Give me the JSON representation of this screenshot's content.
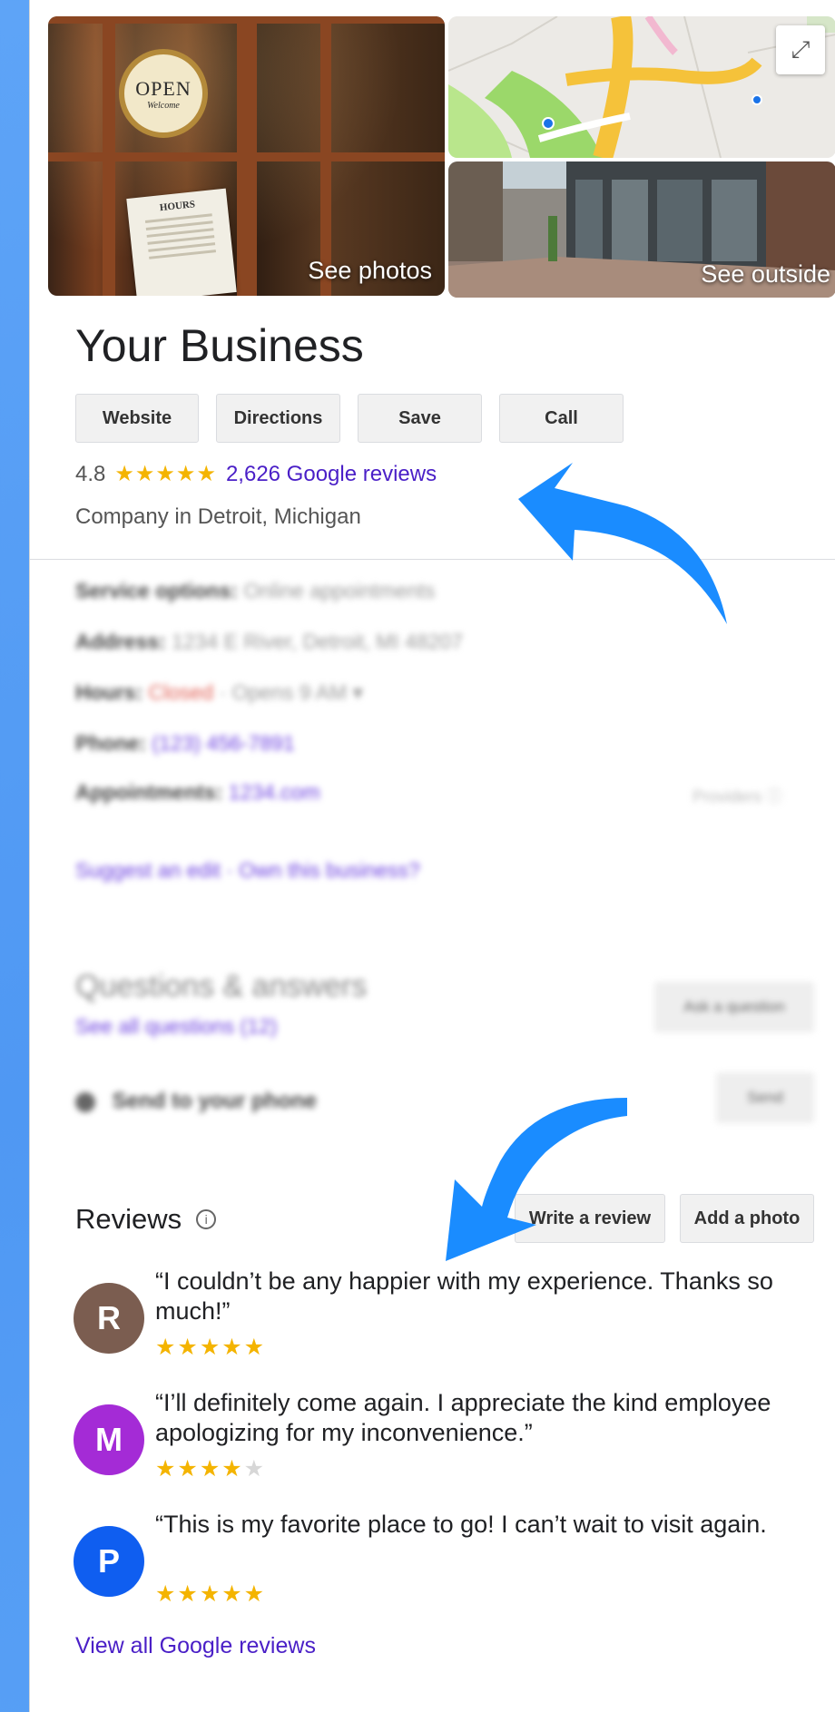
{
  "photos": {
    "open_sign": {
      "line1": "OPEN",
      "line2": "Welcome"
    },
    "hours_sign": "HOURS",
    "see_photos_label": "See photos",
    "see_outside_label": "See outside"
  },
  "business": {
    "name": "Your Business",
    "actions": [
      "Website",
      "Directions",
      "Save",
      "Call"
    ],
    "rating": "4.8",
    "rating_stars": "★★★★★",
    "reviews_link": "2,626 Google reviews",
    "category": "Company in Detroit, Michigan"
  },
  "info": {
    "service_label": "Service options:",
    "service_value": "Online appointments",
    "address_label": "Address:",
    "address_value": "1234 E River, Detroit, MI 48207",
    "hours_label": "Hours:",
    "hours_status": "Closed",
    "hours_value": "· Opens 9 AM ▾",
    "phone_label": "Phone:",
    "phone_value": "(123) 456-7891",
    "appointments_label": "Appointments:",
    "appointments_value": "1234.com",
    "providers": "Providers ⓘ",
    "suggest_edit": "Suggest an edit · Own this business?"
  },
  "qa": {
    "title": "Questions & answers",
    "see_all": "See all questions (12)",
    "ask_button": "Ask a question",
    "send_label": "Send to your phone",
    "send_button": "Send"
  },
  "reviews": {
    "title": "Reviews",
    "write_button": "Write a review",
    "add_photo_button": "Add a photo",
    "items": [
      {
        "initial": "R",
        "color": "#7b5d50",
        "text": "“I couldn’t be any happier with my experience. Thanks so much!”",
        "stars": 5
      },
      {
        "initial": "M",
        "color": "#a42bd6",
        "text": "“I’ll definitely come again. I appreciate the kind employee apologizing for my inconvenience.”",
        "stars": 4
      },
      {
        "initial": "P",
        "color": "#0f5ef0",
        "text": "“This is my favorite place to go! I can’t wait to visit again.",
        "stars": 5
      }
    ],
    "view_all": "View all Google reviews"
  },
  "colors": {
    "arrow": "#1a8cff",
    "star": "#f4b400",
    "link": "#4a1fc7"
  }
}
